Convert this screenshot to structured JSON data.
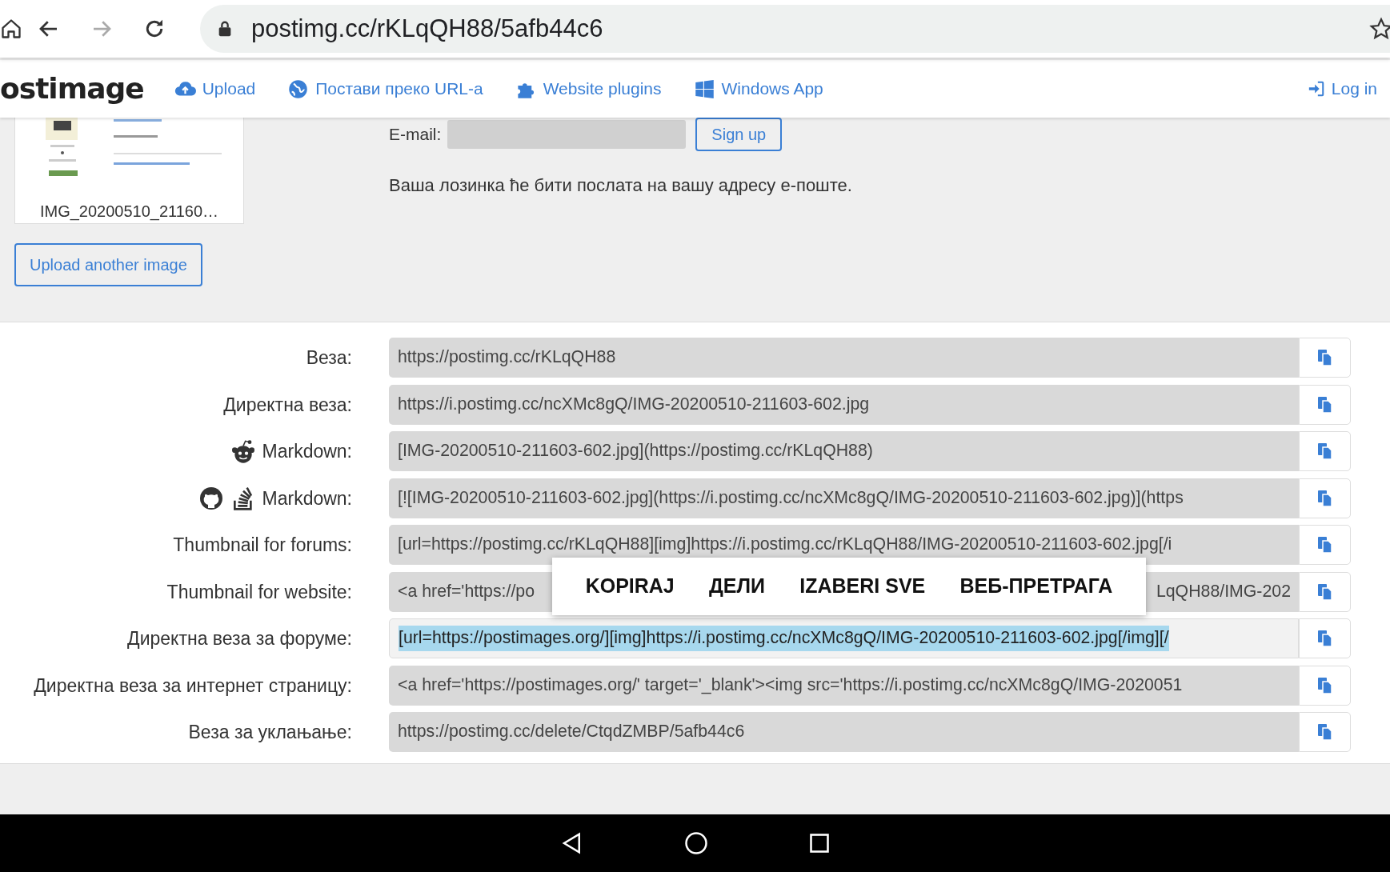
{
  "browser": {
    "buttons": [
      {
        "kind": "home",
        "disabled": false
      },
      {
        "kind": "back",
        "disabled": false
      },
      {
        "kind": "forward",
        "disabled": true
      },
      {
        "kind": "reload",
        "disabled": false
      }
    ],
    "url": "postimg.cc/rKLqQH88/5afb44c6"
  },
  "navbar": {
    "logo": "ostimage",
    "items": [
      {
        "kind": "upload",
        "label": "Upload"
      },
      {
        "kind": "globe",
        "label": "Постави преко URL-а"
      },
      {
        "kind": "plugin",
        "label": "Website plugins"
      },
      {
        "kind": "windows",
        "label": "Windows App"
      }
    ],
    "login": "Log in"
  },
  "thumbnail": {
    "kind": "picture",
    "caption": "IMG_20200510_21160…"
  },
  "upload_another": "Upload another image",
  "signup": {
    "email_label": "E-mail:",
    "button": "Sign up",
    "note": "Ваша лозинка ће бити послата на вашу адресу е-поште."
  },
  "links": [
    {
      "kind": "plain",
      "label": "Веза:",
      "value": "https://postimg.cc/rKLqQH88",
      "selected": false
    },
    {
      "kind": "plain",
      "label": "Директна веза:",
      "value": "https://i.postimg.cc/ncXMc8gQ/IMG-20200510-211603-602.jpg",
      "selected": false
    },
    {
      "kind": "reddit",
      "label": "Markdown:",
      "value": "[IMG-20200510-211603-602.jpg](https://postimg.cc/rKLqQH88)",
      "selected": false
    },
    {
      "kind": "github",
      "label": "Markdown:",
      "value": "[![IMG-20200510-211603-602.jpg](https://i.postimg.cc/ncXMc8gQ/IMG-20200510-211603-602.jpg)](https",
      "selected": false
    },
    {
      "kind": "plain",
      "label": "Thumbnail for forums:",
      "value": "[url=https://postimg.cc/rKLqQH88][img]https://i.postimg.cc/rKLqQH88/IMG-20200510-211603-602.jpg[/i",
      "selected": false
    },
    {
      "kind": "split",
      "label": "Thumbnail for website:",
      "value": "<a href='https://po",
      "value_end": "LqQH88/IMG-202",
      "selected": false
    },
    {
      "kind": "plain",
      "label": "Директна веза за форуме:",
      "value": "[url=https://postimages.org/][img]https://i.postimg.cc/ncXMc8gQ/IMG-20200510-211603-602.jpg[/img][/",
      "selected": true
    },
    {
      "kind": "plain",
      "label": "Директна веза за интернет страницу:",
      "value": "<a href='https://postimages.org/' target='_blank'><img src='https://i.postimg.cc/ncXMc8gQ/IMG-2020051",
      "selected": false
    },
    {
      "kind": "plain",
      "label": "Веза за уклањање:",
      "value": "https://postimg.cc/delete/CtqdZMBP/5afb44c6",
      "selected": false
    }
  ],
  "context_menu": [
    "KOPIRAJ",
    "ДЕЛИ",
    "IZABERI SVE",
    "ВЕБ-ПРЕТРАГА"
  ]
}
